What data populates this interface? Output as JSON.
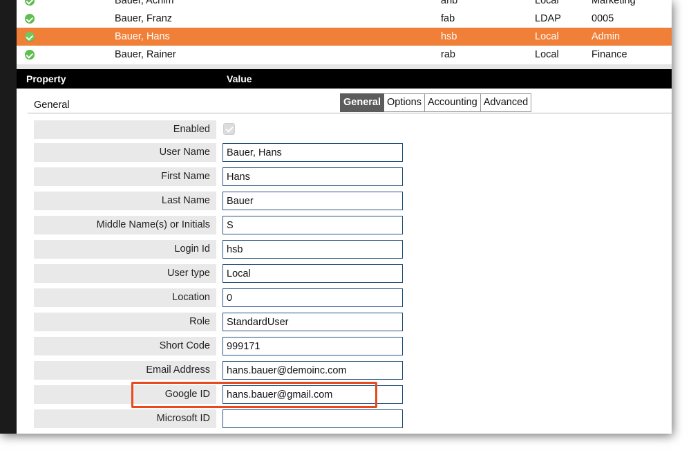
{
  "user_list": {
    "rows": [
      {
        "name": "Bauer, Achim",
        "login": "ahb",
        "source": "Local",
        "department": "Marketing",
        "selected": false
      },
      {
        "name": "Bauer, Franz",
        "login": "fab",
        "source": "LDAP",
        "department": "0005",
        "selected": false
      },
      {
        "name": "Bauer, Hans",
        "login": "hsb",
        "source": "Local",
        "department": "Admin",
        "selected": true
      },
      {
        "name": "Bauer, Rainer",
        "login": "rab",
        "source": "Local",
        "department": "Finance",
        "selected": false
      }
    ]
  },
  "property_header": {
    "property": "Property",
    "value": "Value"
  },
  "section": {
    "title": "General"
  },
  "tabs": [
    {
      "label": "General",
      "active": true
    },
    {
      "label": "Options",
      "active": false
    },
    {
      "label": "Accounting",
      "active": false
    },
    {
      "label": "Advanced",
      "active": false
    }
  ],
  "form": {
    "enabled": {
      "label": "Enabled",
      "checked": true
    },
    "user_name": {
      "label": "User Name",
      "value": "Bauer, Hans"
    },
    "first_name": {
      "label": "First Name",
      "value": "Hans"
    },
    "last_name": {
      "label": "Last Name",
      "value": "Bauer"
    },
    "middle_name": {
      "label": "Middle Name(s) or Initials",
      "value": "S"
    },
    "login_id": {
      "label": "Login Id",
      "value": "hsb"
    },
    "user_type": {
      "label": "User type",
      "value": "Local"
    },
    "location": {
      "label": "Location",
      "value": "0"
    },
    "role": {
      "label": "Role",
      "value": "StandardUser"
    },
    "short_code": {
      "label": "Short Code",
      "value": "999171"
    },
    "email_address": {
      "label": "Email Address",
      "value": "hans.bauer@demoinc.com"
    },
    "google_id": {
      "label": "Google ID",
      "value": "hans.bauer@gmail.com"
    },
    "microsoft_id": {
      "label": "Microsoft ID",
      "value": ""
    }
  },
  "colors": {
    "selected_row": "#f07f37",
    "header_bg": "#000000",
    "active_tab": "#5c5c5c",
    "field_border": "#24507e",
    "highlight": "#e8491d",
    "status_ok": "#5fbf4f"
  },
  "icons": {
    "status": "check-circle-icon",
    "enabled": "checkbox-checked-icon"
  }
}
